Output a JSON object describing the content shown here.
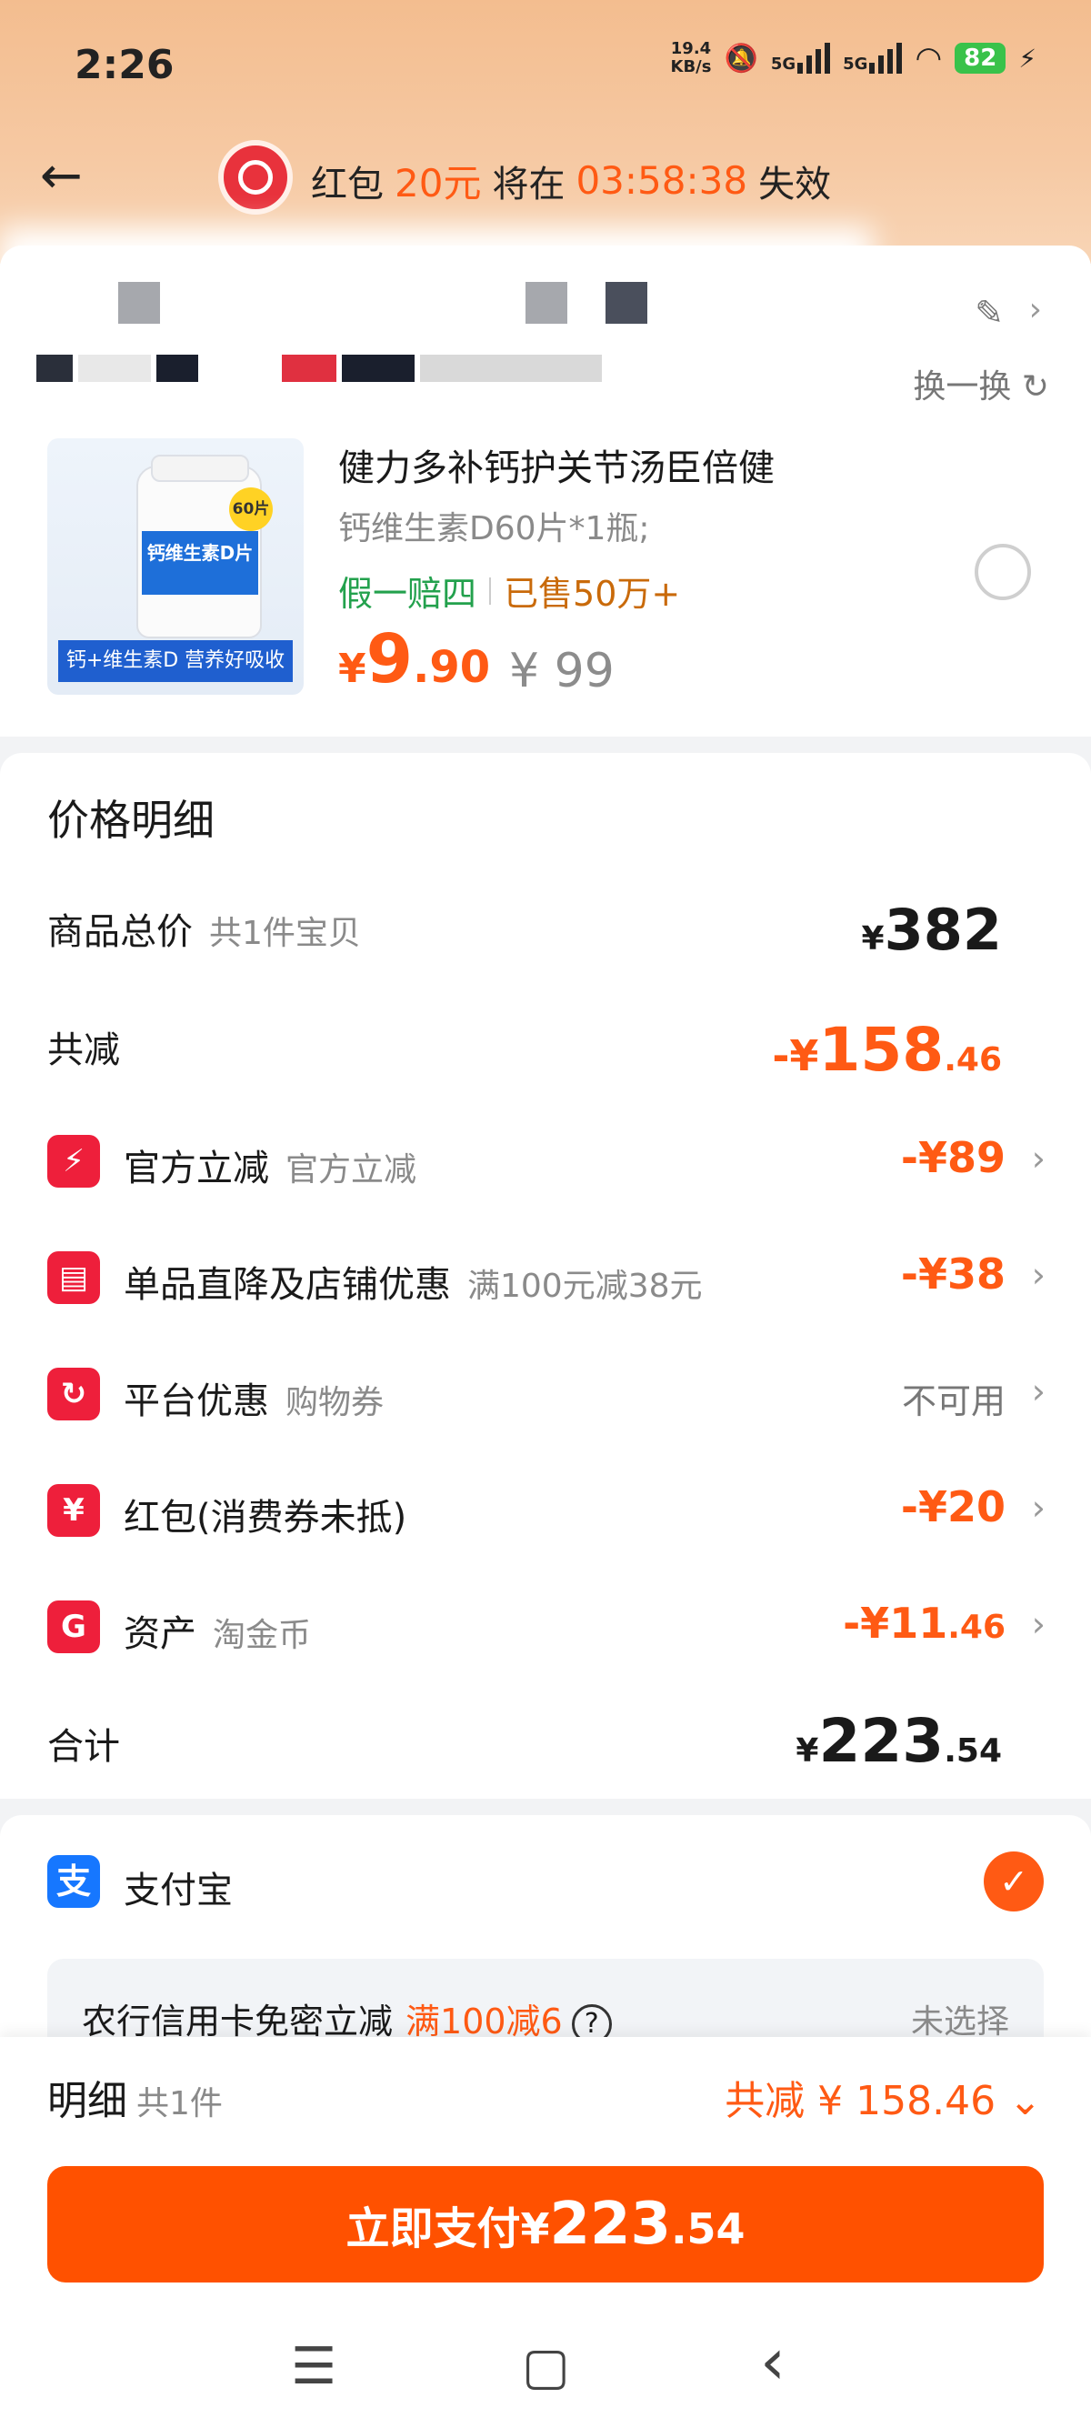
{
  "status_bar": {
    "time": "2:26",
    "net_speed_value": "19.4",
    "net_speed_unit": "KB/s",
    "sim1": "5G",
    "sim2": "5G",
    "battery": "82"
  },
  "header": {
    "back_icon": "←",
    "banner_part1": "红包",
    "banner_amount": "20元",
    "banner_part2": "将在",
    "banner_countdown": "03:58:38",
    "banner_part3": "失效"
  },
  "shop": {
    "swap_label": "换一换"
  },
  "product": {
    "image_label": "钙+维生素D 营养好吸收",
    "image_tag": "60片",
    "bottle_label": "钙维生素D片",
    "title": "健力多补钙护关节汤臣倍健",
    "sku": "钙维生素D60片*1瓶;",
    "tag_guarantee": "假一赔四",
    "tag_sold": "已售50万+",
    "price_symbol": "¥",
    "price_int": "9",
    "price_dec": ".90",
    "original_price": "¥ 99"
  },
  "price_detail": {
    "title": "价格明细",
    "total_label": "商品总价",
    "total_sub": "共1件宝贝",
    "total_symbol": "¥",
    "total_value": "382",
    "reduce_label": "共减",
    "reduce_prefix": "-¥",
    "reduce_int": "158",
    "reduce_dec": ".46",
    "items": [
      {
        "label": "官方立减",
        "sub": "官方立减",
        "value": "-¥89",
        "icon": "⚡"
      },
      {
        "label": "单品直降及店铺优惠",
        "sub": "满100元减38元",
        "value": "-¥38",
        "icon": "▤"
      },
      {
        "label": "平台优惠",
        "sub": "购物券",
        "value": "不可用",
        "icon": "↻"
      },
      {
        "label": "红包(消费券未抵)",
        "sub": "",
        "value": "-¥20",
        "icon": "¥"
      },
      {
        "label": "资产",
        "sub": "淘金币",
        "value_int": "-¥11",
        "value_dec": ".46",
        "icon": "G"
      }
    ],
    "sum_label": "合计",
    "sum_symbol": "¥",
    "sum_int": "223",
    "sum_dec": ".54"
  },
  "payment": {
    "method": "支付宝",
    "method_icon": "支",
    "promo_text": "农行信用卡免密立减",
    "promo_highlight": "满100减6",
    "promo_status": "未选择"
  },
  "bottom": {
    "detail_label": "明细",
    "detail_count": "共1件",
    "detail_reduce": "共减 ¥ 158.46",
    "pay_label": "立即支付",
    "pay_symbol": "¥",
    "pay_int": "223",
    "pay_dec": ".54"
  },
  "nav": {
    "menu_icon": "☰",
    "home_icon": "▢",
    "back_icon": "‹"
  },
  "colors": {
    "accent": "#ff5a14",
    "pay_button": "#ff5100",
    "green_tag": "#23a14d",
    "icon_red": "#ee1f3b",
    "alipay_blue": "#1677ff"
  }
}
